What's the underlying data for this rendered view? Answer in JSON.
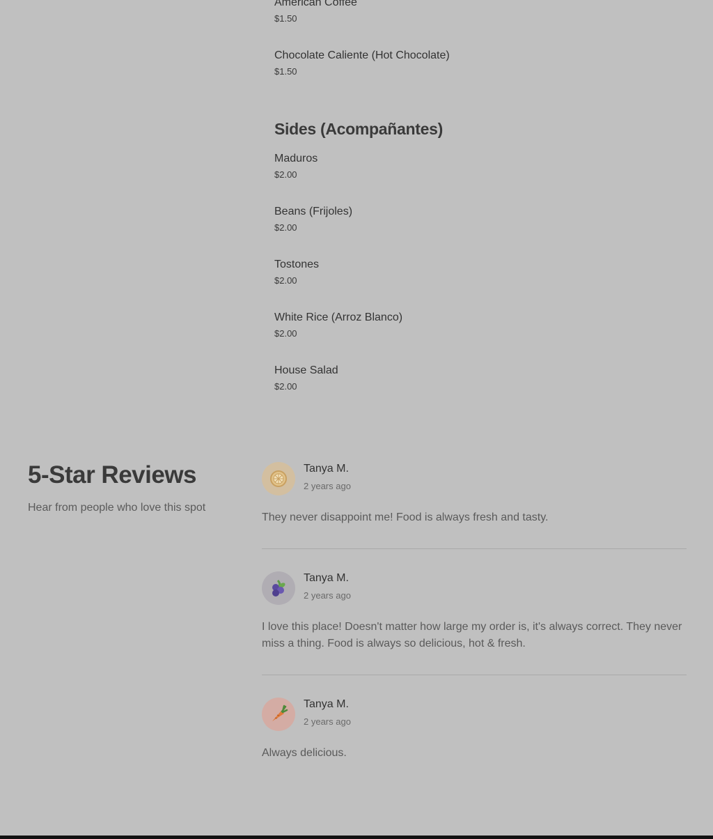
{
  "menu": {
    "drinks_items": [
      {
        "name": "American Coffee",
        "price": "$1.50"
      },
      {
        "name": "Chocolate Caliente (Hot Chocolate)",
        "price": "$1.50"
      }
    ],
    "sides_title": "Sides (Acompañantes)",
    "sides_items": [
      {
        "name": "Maduros",
        "price": "$2.00"
      },
      {
        "name": "Beans (Frijoles)",
        "price": "$2.00"
      },
      {
        "name": "Tostones",
        "price": "$2.00"
      },
      {
        "name": "White Rice (Arroz Blanco)",
        "price": "$2.00"
      },
      {
        "name": "House Salad",
        "price": "$2.00"
      }
    ]
  },
  "reviews": {
    "title": "5-Star Reviews",
    "subtitle": "Hear from people who love this spot",
    "items": [
      {
        "name": "Tanya M.",
        "date": "2 years ago",
        "text": "They never disappoint me! Food is always fresh and tasty.",
        "avatar_icon": "lemon-icon",
        "avatar_color": "#d3bfa0"
      },
      {
        "name": "Tanya M.",
        "date": "2 years ago",
        "text": "I love this place! Doesn't matter how large my order is, it's always correct. They never miss a thing. Food is always so delicious, hot & fresh.",
        "avatar_icon": "blueberry-icon",
        "avatar_color": "#b0adb3"
      },
      {
        "name": "Tanya M.",
        "date": "2 years ago",
        "text": "Always delicious.",
        "avatar_icon": "carrot-icon",
        "avatar_color": "#d4aca4"
      }
    ]
  }
}
